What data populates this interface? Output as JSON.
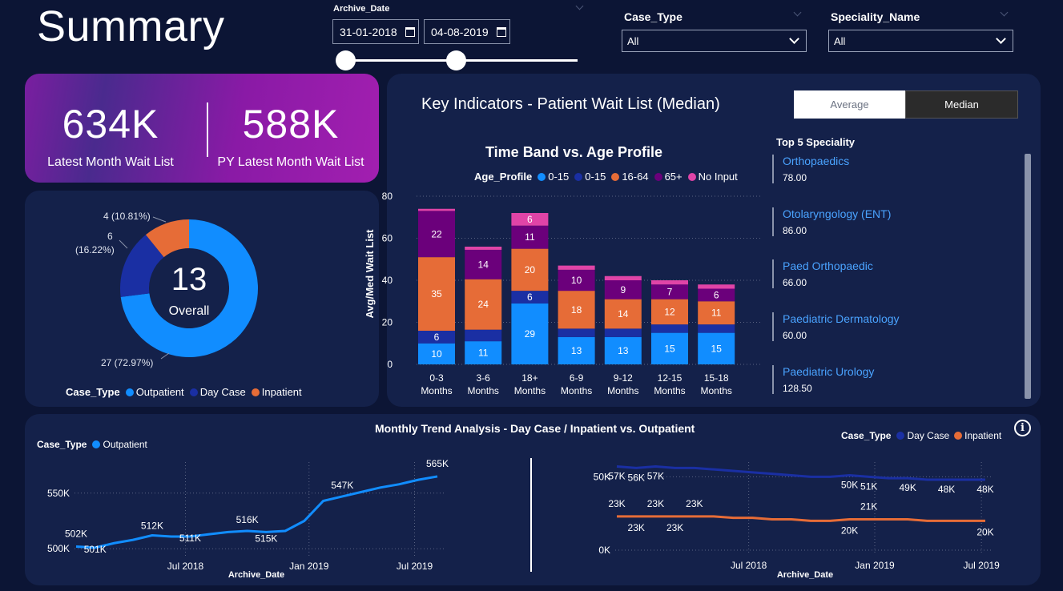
{
  "header": {
    "title": "Summary"
  },
  "filters": {
    "archive_date": {
      "label": "Archive_Date",
      "start": "31-01-2018",
      "end": "04-08-2019"
    },
    "case_type": {
      "label": "Case_Type",
      "value": "All"
    },
    "speciality_name": {
      "label": "Speciality_Name",
      "value": "All"
    }
  },
  "kpis": {
    "latest": {
      "value": "634K",
      "label": "Latest Month Wait List"
    },
    "py_latest": {
      "value": "588K",
      "label": "PY Latest Month Wait List"
    }
  },
  "donut": {
    "center_value": "13",
    "center_label": "Overall",
    "legend_title": "Case_Type",
    "colors": {
      "Outpatient": "#118dff",
      "Day Case": "#1a2fa3",
      "Inpatient": "#e66c37"
    },
    "segments": [
      {
        "name": "Outpatient",
        "value": 27,
        "label": "27 (72.97%)"
      },
      {
        "name": "Day Case",
        "value": 6,
        "label_line1": "6",
        "label_line2": "(16.22%)"
      },
      {
        "name": "Inpatient",
        "value": 4,
        "label": "4 (10.81%)"
      }
    ]
  },
  "key_indicators": {
    "title": "Key Indicators - Patient Wait List (Median)",
    "toggle": {
      "average": "Average",
      "median": "Median",
      "selected": "Median"
    }
  },
  "bar_chart": {
    "title": "Time Band vs. Age Profile",
    "legend_title": "Age_Profile",
    "ylabel": "Avg/Med Wait List"
  },
  "top5": {
    "title": "Top 5 Speciality",
    "items": [
      {
        "name": "Orthopaedics",
        "value": "78.00"
      },
      {
        "name": "Otolaryngology (ENT)",
        "value": "86.00"
      },
      {
        "name": "Paed Orthopaedic",
        "value": "66.00"
      },
      {
        "name": "Paediatric Dermatology",
        "value": "60.00"
      },
      {
        "name": "Paediatric Urology",
        "value": "128.50"
      }
    ]
  },
  "trend": {
    "title": "Monthly Trend Analysis - Day Case / Inpatient vs. Outpatient",
    "left_legend_title": "Case_Type",
    "left_legend_item": "Outpatient",
    "right_legend_title": "Case_Type",
    "right_legend_items": [
      "Day Case",
      "Inpatient"
    ],
    "xlabel": "Archive_Date",
    "info_icon": "info-icon"
  },
  "chart_data": [
    {
      "type": "bar",
      "title": "Time Band vs. Age Profile",
      "stacked": true,
      "ylabel": "Avg/Med Wait List",
      "ylim": [
        0,
        80
      ],
      "yticks": [
        0,
        20,
        40,
        60,
        80
      ],
      "categories": [
        "0-3 Months",
        "3-6 Months",
        "18+ Months",
        "6-9 Months",
        "9-12 Months",
        "12-15 Months",
        "15-18 Months"
      ],
      "legend_position": "top",
      "series": [
        {
          "name": "0-15",
          "color": "#118dff",
          "values": [
            10,
            11,
            29,
            13,
            13,
            15,
            15
          ],
          "labels": [
            "10",
            "11",
            "29",
            "13",
            "13",
            "15",
            "15"
          ]
        },
        {
          "name": "0-15",
          "color": "#1a2fa3",
          "values": [
            6,
            5.5,
            6,
            4,
            4,
            4,
            4
          ],
          "labels": [
            "6",
            "",
            "6",
            "",
            "",
            "",
            ""
          ]
        },
        {
          "name": "16-64",
          "color": "#e66c37",
          "values": [
            35,
            24,
            20,
            18,
            14,
            12,
            11
          ],
          "labels": [
            "35",
            "24",
            "20",
            "18",
            "14",
            "12",
            "11"
          ]
        },
        {
          "name": "65+",
          "color": "#6b007b",
          "values": [
            22,
            14,
            11,
            10,
            9,
            7,
            6
          ],
          "labels": [
            "22",
            "14",
            "11",
            "10",
            "9",
            "7",
            "6"
          ]
        },
        {
          "name": "No Input",
          "color": "#e044a7",
          "values": [
            1,
            1.5,
            6,
            2,
            2,
            2,
            2
          ],
          "labels": [
            "",
            "",
            "6",
            "",
            "",
            "",
            ""
          ]
        }
      ]
    },
    {
      "type": "line",
      "title": "Outpatient",
      "xlabel": "Archive_Date",
      "xticks": [
        "Jul 2018",
        "Jan 2019",
        "Jul 2019"
      ],
      "yticks": [
        "500K",
        "550K"
      ],
      "ylim": [
        498,
        570
      ],
      "color": "#118dff",
      "series": [
        {
          "name": "Outpatient",
          "values": [
            502,
            501,
            505,
            508,
            512,
            511,
            511,
            513,
            515,
            516,
            515,
            516,
            525,
            543,
            547,
            551,
            555,
            558,
            562,
            565
          ]
        }
      ],
      "data_labels": [
        {
          "index": 0,
          "text": "502K"
        },
        {
          "index": 1,
          "text": "501K"
        },
        {
          "index": 4,
          "text": "512K"
        },
        {
          "index": 6,
          "text": "511K"
        },
        {
          "index": 9,
          "text": "516K"
        },
        {
          "index": 10,
          "text": "515K"
        },
        {
          "index": 14,
          "text": "547K"
        },
        {
          "index": 19,
          "text": "565K"
        }
      ]
    },
    {
      "type": "line",
      "title": "Day Case / Inpatient",
      "xlabel": "Archive_Date",
      "xticks": [
        "Jul 2018",
        "Jan 2019",
        "Jul 2019"
      ],
      "yticks": [
        "0K",
        "50K"
      ],
      "ylim": [
        0,
        60
      ],
      "series": [
        {
          "name": "Day Case",
          "color": "#1a2fa3",
          "values": [
            57,
            56,
            57,
            56,
            56,
            55,
            54,
            53,
            52,
            51,
            50,
            50,
            51,
            50,
            49,
            49,
            48,
            48,
            48,
            48
          ]
        },
        {
          "name": "Inpatient",
          "color": "#e66c37",
          "values": [
            23,
            23,
            23,
            23,
            23,
            23,
            22,
            22,
            21,
            21,
            20,
            20,
            21,
            21,
            21,
            21,
            20,
            20,
            20,
            20
          ]
        }
      ],
      "data_labels_daycase": [
        {
          "index": 0,
          "text": "57K"
        },
        {
          "index": 1,
          "text": "56K"
        },
        {
          "index": 2,
          "text": "57K"
        },
        {
          "index": 12,
          "text": "50K"
        },
        {
          "index": 13,
          "text": "51K"
        },
        {
          "index": 15,
          "text": "49K"
        },
        {
          "index": 17,
          "text": "48K"
        },
        {
          "index": 19,
          "text": "48K"
        }
      ],
      "data_labels_inpatient": [
        {
          "index": 0,
          "text": "23K"
        },
        {
          "index": 1,
          "text": "23K"
        },
        {
          "index": 2,
          "text": "23K"
        },
        {
          "index": 3,
          "text": "23K"
        },
        {
          "index": 4,
          "text": "23K"
        },
        {
          "index": 12,
          "text": "20K"
        },
        {
          "index": 13,
          "text": "21K"
        },
        {
          "index": 19,
          "text": "20K"
        }
      ]
    }
  ]
}
